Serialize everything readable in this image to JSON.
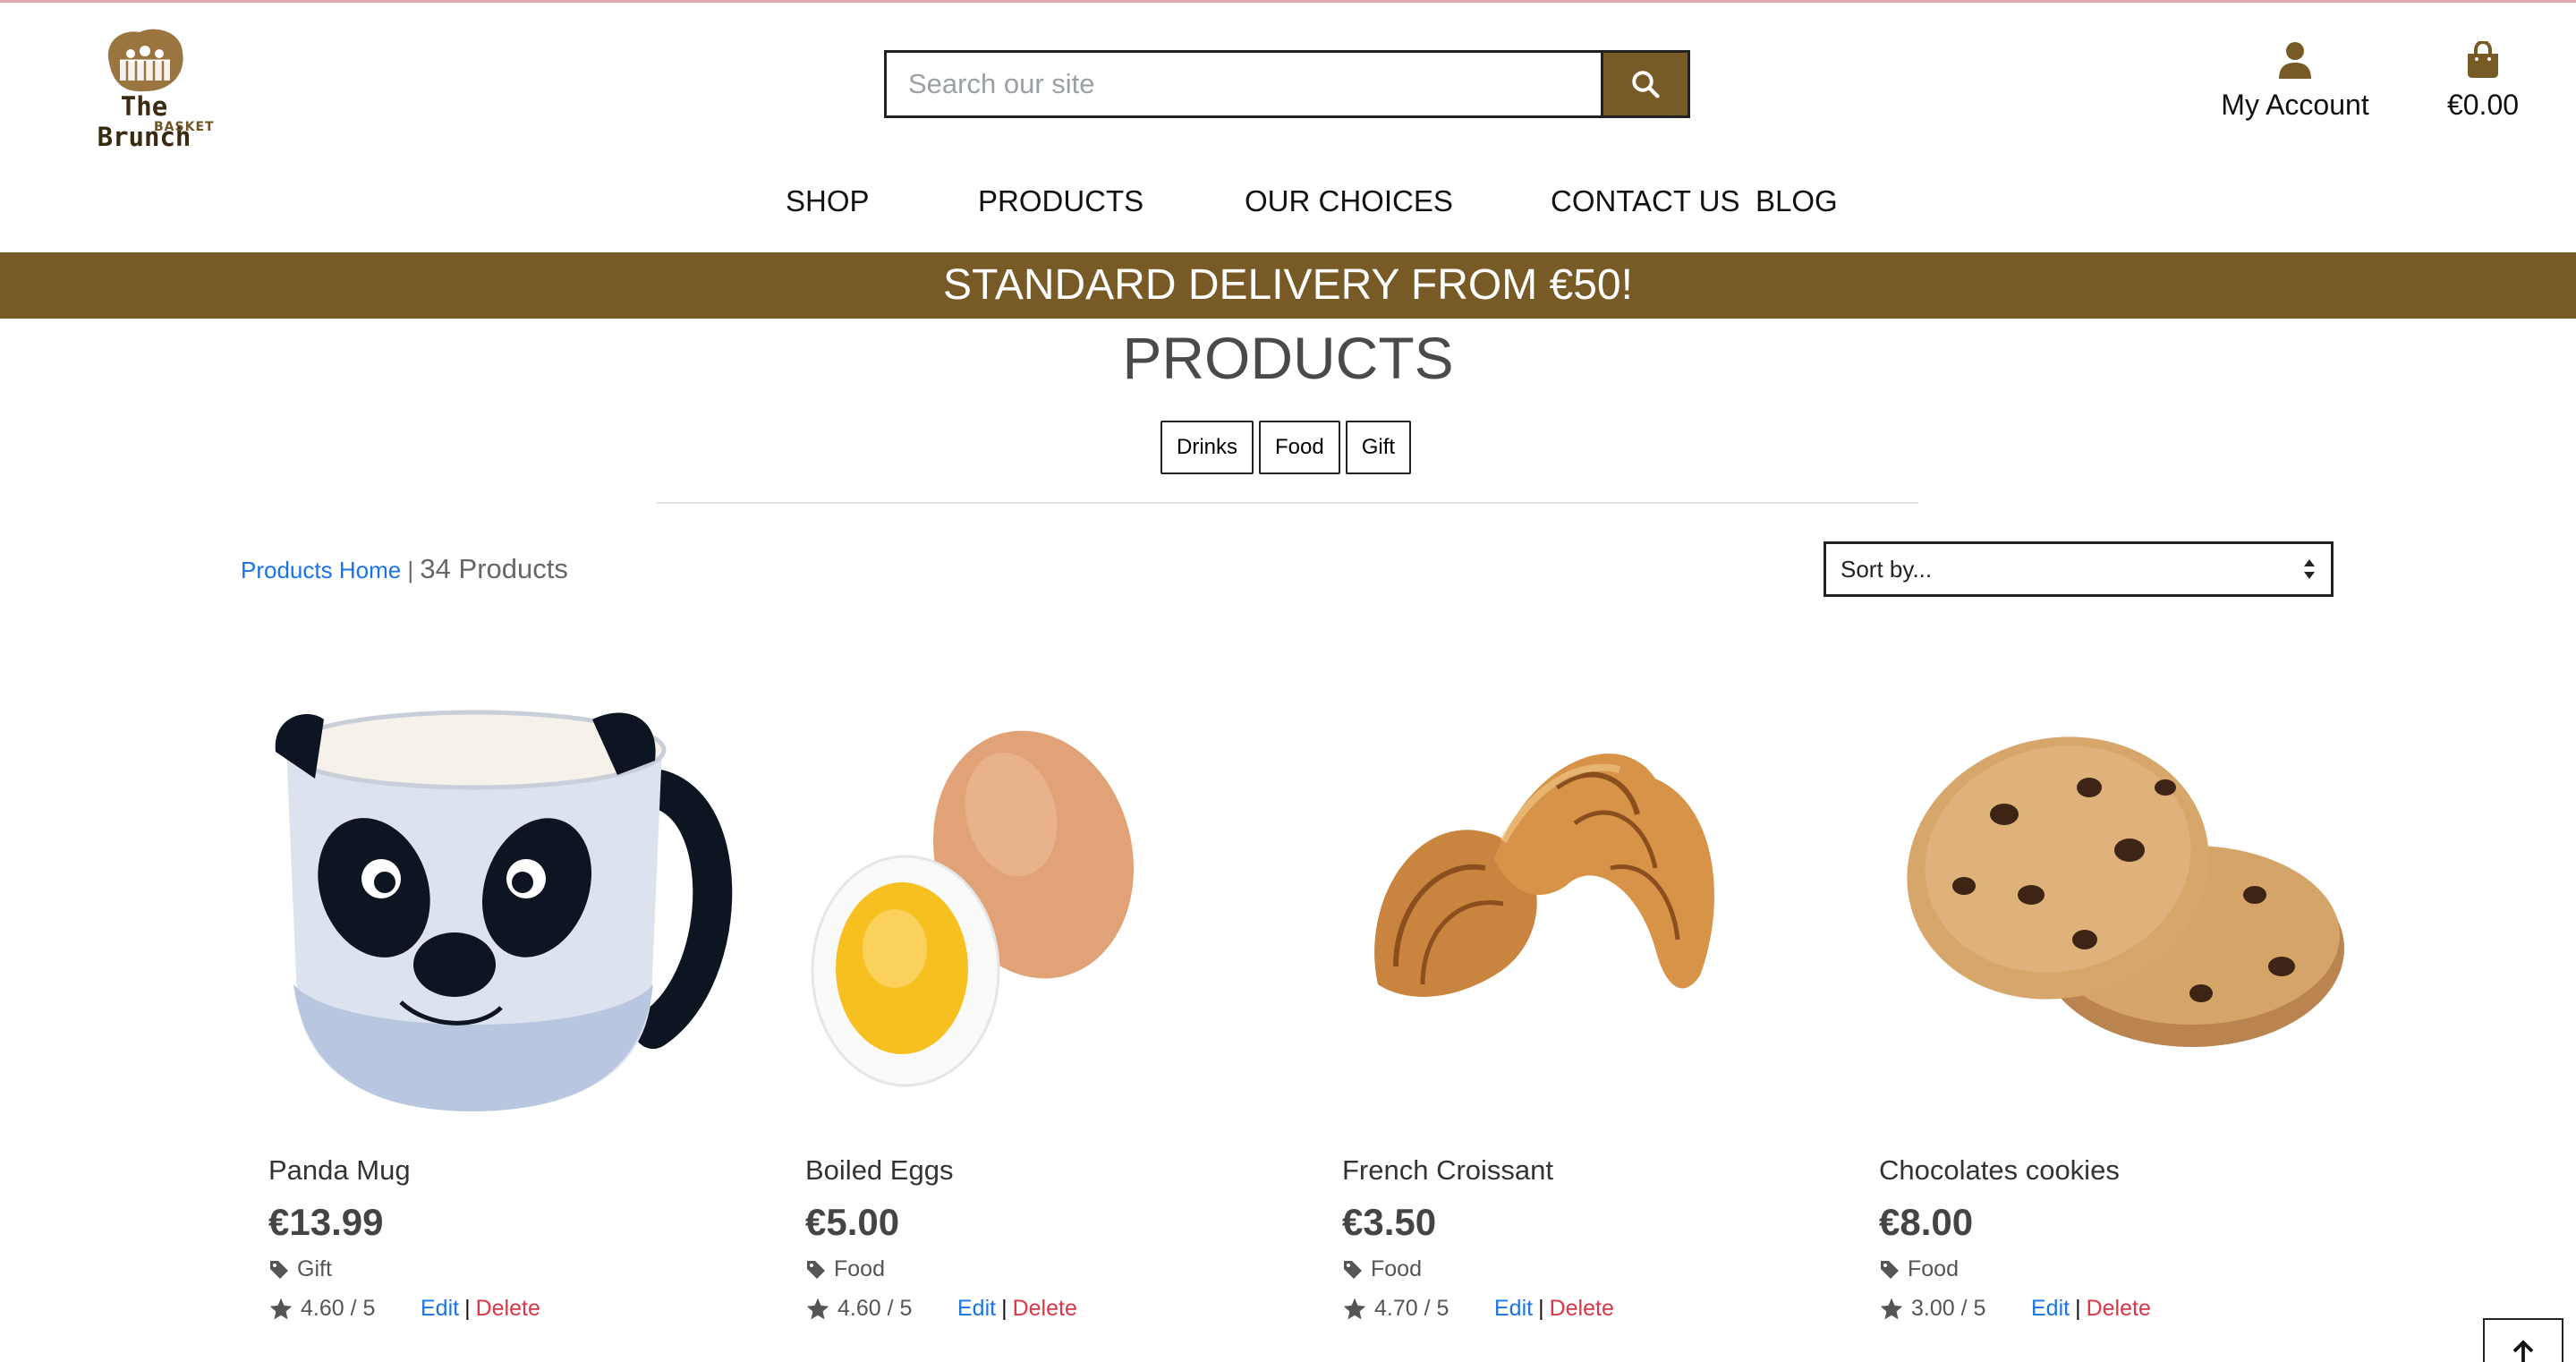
{
  "brand": {
    "name": "The Brunch",
    "sub": "BASKET",
    "color": "#775a26"
  },
  "search": {
    "placeholder": "Search our site"
  },
  "header": {
    "account_label": "My Account",
    "cart_total": "€0.00"
  },
  "nav": {
    "items": [
      {
        "label": "SHOP"
      },
      {
        "label": "PRODUCTS"
      },
      {
        "label": "OUR CHOICES"
      },
      {
        "label": "CONTACT US"
      },
      {
        "label": "BLOG"
      }
    ]
  },
  "banner": {
    "text": "STANDARD DELIVERY FROM €50!"
  },
  "main": {
    "title": "PRODUCTS",
    "categories": [
      {
        "label": "Drinks"
      },
      {
        "label": "Food"
      },
      {
        "label": "Gift"
      }
    ],
    "breadcrumb": {
      "home_label": "Products Home",
      "separator": "|",
      "count": "34 Products"
    },
    "sort": {
      "selected": "Sort by..."
    }
  },
  "products": [
    {
      "name": "Panda Mug",
      "price": "€13.99",
      "category": "Gift",
      "rating": "4.60 / 5",
      "edit": "Edit",
      "sep": "|",
      "delete": "Delete"
    },
    {
      "name": "Boiled Eggs",
      "price": "€5.00",
      "category": "Food",
      "rating": "4.60 / 5",
      "edit": "Edit",
      "sep": "|",
      "delete": "Delete"
    },
    {
      "name": "French Croissant",
      "price": "€3.50",
      "category": "Food",
      "rating": "4.70 / 5",
      "edit": "Edit",
      "sep": "|",
      "delete": "Delete"
    },
    {
      "name": "Chocolates cookies",
      "price": "€8.00",
      "category": "Food",
      "rating": "3.00 / 5",
      "edit": "Edit",
      "sep": "|",
      "delete": "Delete"
    }
  ],
  "icons": {
    "search": "search-icon",
    "account": "user-icon",
    "cart": "shopping-bag-icon",
    "sort": "sort-arrows-icon",
    "tag": "tag-icon",
    "star": "star-icon",
    "to_top": "arrow-up-icon"
  }
}
